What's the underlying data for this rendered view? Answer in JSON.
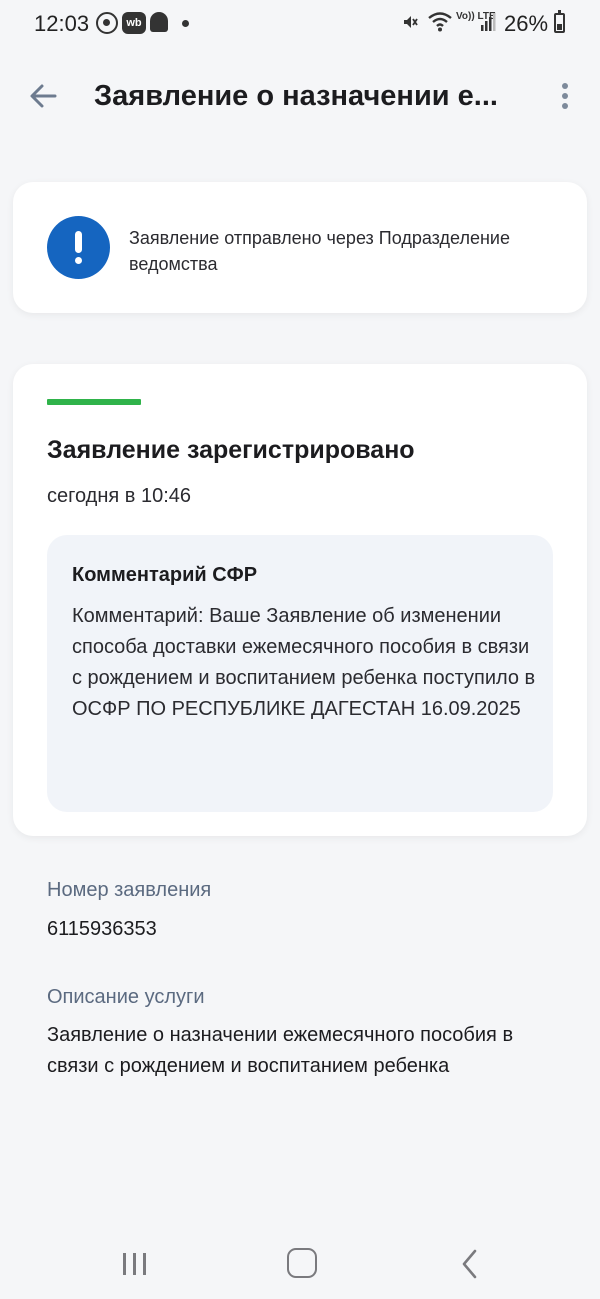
{
  "status_bar": {
    "time": "12:03",
    "battery": "26%",
    "volte": "Vo)) LTE",
    "app_icons": [
      "whatsapp-icon",
      "wb-icon",
      "snapchat-icon",
      "dot"
    ],
    "wb_label": "wb"
  },
  "header": {
    "title": "Заявление о назначении е..."
  },
  "notice": {
    "text": "Заявление отправлено через Подразделение ведомства",
    "icon": "exclamation-icon",
    "icon_color": "#1565c0"
  },
  "status": {
    "progress_color": "#2fb34a",
    "title": "Заявление зарегистрировано",
    "time": "сегодня в 10:46",
    "comment": {
      "title": "Комментарий СФР",
      "body": "Комментарий: Ваше Заявление об изменении способа доставки ежемесячного пособия в связи с рождением и воспитанием ребенка поступило в ОСФР ПО РЕСПУБЛИКЕ ДАГЕСТАН 16.09.2025"
    }
  },
  "details": {
    "number_label": "Номер заявления",
    "number_value": "6115936353",
    "description_label": "Описание услуги",
    "description_value": "Заявление о назначении ежемесячного пособия в связи с рождением и воспитанием ребенка"
  },
  "nav_bar": {
    "buttons": [
      "recents",
      "home",
      "back"
    ]
  }
}
